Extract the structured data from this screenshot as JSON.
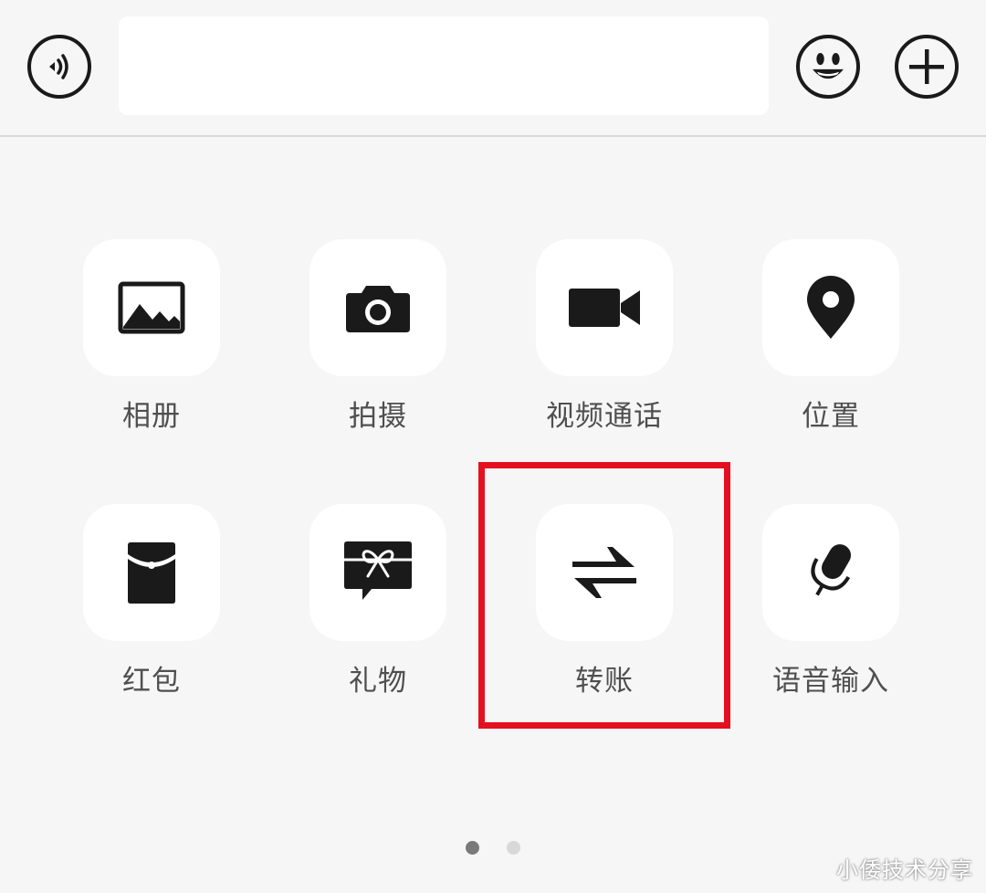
{
  "input_bar": {
    "voice_icon": "voice-wave-icon",
    "text_value": "",
    "emoji_icon": "smiley-icon",
    "plus_icon": "plus-icon"
  },
  "panel": {
    "items": [
      {
        "label": "相册",
        "icon": "photo-album-icon"
      },
      {
        "label": "拍摄",
        "icon": "camera-icon"
      },
      {
        "label": "视频通话",
        "icon": "video-call-icon"
      },
      {
        "label": "位置",
        "icon": "location-pin-icon"
      },
      {
        "label": "红包",
        "icon": "red-packet-icon"
      },
      {
        "label": "礼物",
        "icon": "gift-icon"
      },
      {
        "label": "转账",
        "icon": "transfer-icon"
      },
      {
        "label": "语音输入",
        "icon": "microphone-icon"
      }
    ],
    "highlighted_item": "转账"
  },
  "pagination": {
    "current_page": 1,
    "total_pages": 2
  },
  "colors": {
    "background": "#f6f6f6",
    "tile": "#ffffff",
    "icon": "#1a1a1a",
    "label": "#4f4f4f",
    "highlight_border": "#e4101f"
  },
  "watermark": "小倭技术分享"
}
